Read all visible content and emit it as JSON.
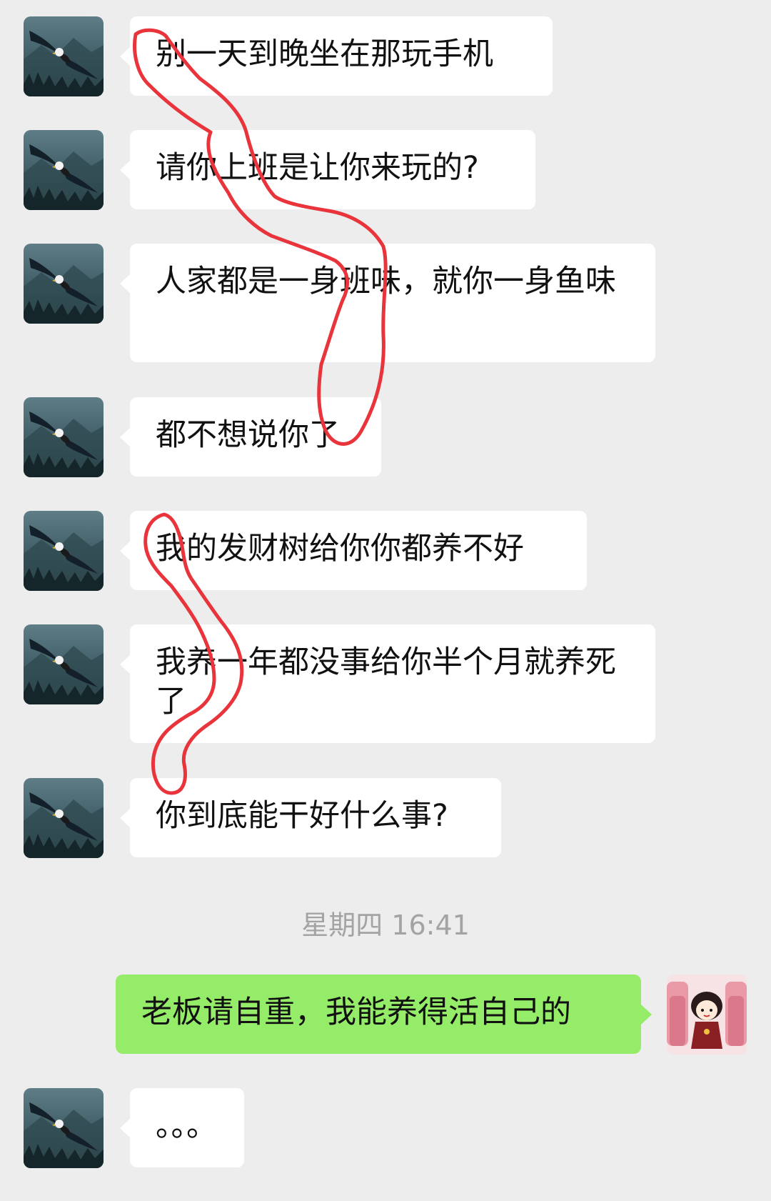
{
  "messages": [
    {
      "text": "别一天到晚坐在那玩手机",
      "side": "left",
      "avatar": "eagle-avatar"
    },
    {
      "text": "请你上班是让你来玩的?",
      "side": "left",
      "avatar": "eagle-avatar"
    },
    {
      "text": "人家都是一身班味，就你一身鱼味",
      "side": "left",
      "avatar": "eagle-avatar"
    },
    {
      "text": "都不想说你了",
      "side": "left",
      "avatar": "eagle-avatar"
    },
    {
      "text": "我的发财树给你你都养不好",
      "side": "left",
      "avatar": "eagle-avatar"
    },
    {
      "text": "我养一年都没事给你半个月就养死了",
      "side": "left",
      "avatar": "eagle-avatar"
    },
    {
      "text": "你到底能干好什么事?",
      "side": "left",
      "avatar": "eagle-avatar"
    },
    {
      "text": "老板请自重，我能养得活自己的",
      "side": "right",
      "avatar": "cartoon-girl-avatar"
    },
    {
      "text": "。。。",
      "side": "left",
      "avatar": "eagle-avatar"
    }
  ],
  "timestamp": "星期四 16:41",
  "colors": {
    "background": "#ededed",
    "incoming_bubble": "#ffffff",
    "outgoing_bubble": "#95ec69",
    "annotation": "#e8343a"
  },
  "annotation": {
    "type": "hand-drawn-red-loop",
    "icon": "red-loop-annotation"
  }
}
